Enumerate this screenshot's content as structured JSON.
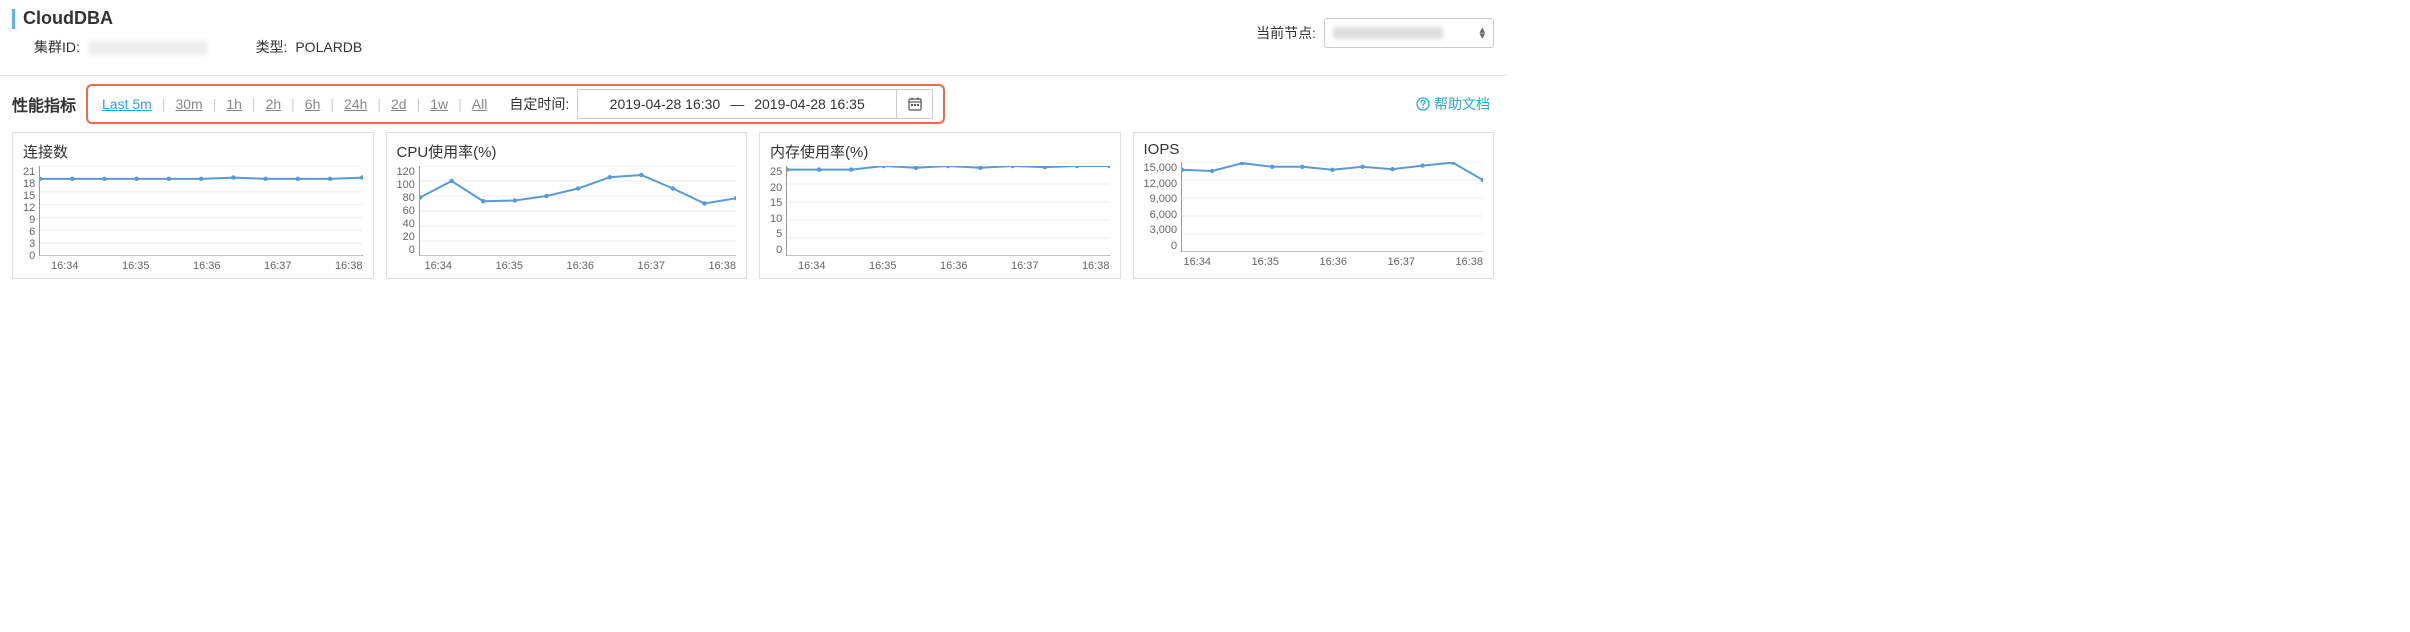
{
  "header": {
    "title": "CloudDBA",
    "cluster_id_label": "集群ID:",
    "type_label": "类型:",
    "type_value": "POLARDB",
    "node_label": "当前节点:"
  },
  "toolbar": {
    "section_title": "性能指标",
    "ranges": [
      "Last 5m",
      "30m",
      "1h",
      "2h",
      "6h",
      "24h",
      "2d",
      "1w",
      "All"
    ],
    "active_range_index": 0,
    "custom_time_label": "自定时间:",
    "date_from": "2019-04-28 16:30",
    "date_sep": "—",
    "date_to": "2019-04-28 16:35",
    "help_label": "帮助文档"
  },
  "charts": [
    {
      "title": "连接数"
    },
    {
      "title": "CPU使用率(%)"
    },
    {
      "title": "内存使用率(%)"
    },
    {
      "title": "IOPS"
    }
  ],
  "chart_data": [
    {
      "type": "line",
      "title": "连接数",
      "categories": [
        "16:34",
        "16:35",
        "16:36",
        "16:37",
        "16:38"
      ],
      "y_ticks": [
        0,
        3,
        6,
        9,
        12,
        15,
        18,
        21
      ],
      "ylim": [
        0,
        21
      ],
      "series": [
        {
          "name": "连接数",
          "x": [
            0,
            1,
            2,
            3,
            4,
            5,
            6,
            7,
            8,
            9,
            10
          ],
          "values": [
            18,
            18,
            18,
            18,
            18,
            18,
            18.3,
            18,
            18,
            18,
            18.3
          ]
        }
      ]
    },
    {
      "type": "line",
      "title": "CPU使用率(%)",
      "categories": [
        "16:34",
        "16:35",
        "16:36",
        "16:37",
        "16:38"
      ],
      "y_ticks": [
        0,
        20,
        40,
        60,
        80,
        100,
        120
      ],
      "ylim": [
        0,
        120
      ],
      "series": [
        {
          "name": "CPU",
          "x": [
            0,
            1,
            2,
            3,
            4,
            5,
            6,
            7,
            8,
            9,
            10
          ],
          "values": [
            78,
            100,
            73,
            74,
            80,
            90,
            105,
            108,
            90,
            70,
            77
          ]
        }
      ]
    },
    {
      "type": "line",
      "title": "内存使用率(%)",
      "categories": [
        "16:34",
        "16:35",
        "16:36",
        "16:37",
        "16:38"
      ],
      "y_ticks": [
        0,
        5,
        10,
        15,
        20,
        25
      ],
      "ylim": [
        0,
        25
      ],
      "series": [
        {
          "name": "内存",
          "x": [
            0,
            1,
            2,
            3,
            4,
            5,
            6,
            7,
            8,
            9,
            10
          ],
          "values": [
            24,
            24,
            24,
            25,
            24.5,
            25,
            24.5,
            25,
            24.7,
            25,
            25
          ]
        }
      ]
    },
    {
      "type": "line",
      "title": "IOPS",
      "categories": [
        "16:34",
        "16:35",
        "16:36",
        "16:37",
        "16:38"
      ],
      "y_ticks": [
        0,
        3000,
        6000,
        9000,
        12000,
        15000
      ],
      "y_tick_labels": [
        "0",
        "3,000",
        "6,000",
        "9,000",
        "12,000",
        "15,000"
      ],
      "ylim": [
        0,
        15000
      ],
      "series": [
        {
          "name": "IOPS",
          "x": [
            0,
            1,
            2,
            3,
            4,
            5,
            6,
            7,
            8,
            9,
            10
          ],
          "values": [
            13700,
            13500,
            14800,
            14200,
            14200,
            13700,
            14200,
            13800,
            14400,
            14900,
            12000
          ]
        }
      ]
    }
  ]
}
